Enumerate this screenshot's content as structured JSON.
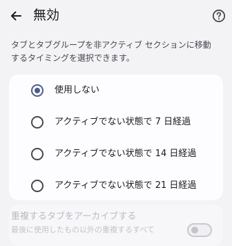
{
  "header": {
    "title": "無効",
    "back_icon": "arrow-back-icon",
    "help_icon": "help-circle-icon"
  },
  "description": "タブとタブグループを非アクティブ セクションに移動するタイミングを選択できます。",
  "options": [
    {
      "label": "使用しない",
      "selected": true
    },
    {
      "label": "アクティブでない状態で 7 日経過",
      "selected": false
    },
    {
      "label": "アクティブでない状態で 14 日経過",
      "selected": false
    },
    {
      "label": "アクティブでない状態で 21 日経過",
      "selected": false
    }
  ],
  "archive": {
    "title": "重複するタブをアーカイブする",
    "subtitle": "最後に使用したもの以外の重複するすべて",
    "enabled": false
  },
  "colors": {
    "background": "#f3f3f6",
    "card": "#fdfcff",
    "accent": "#4b5c92"
  }
}
